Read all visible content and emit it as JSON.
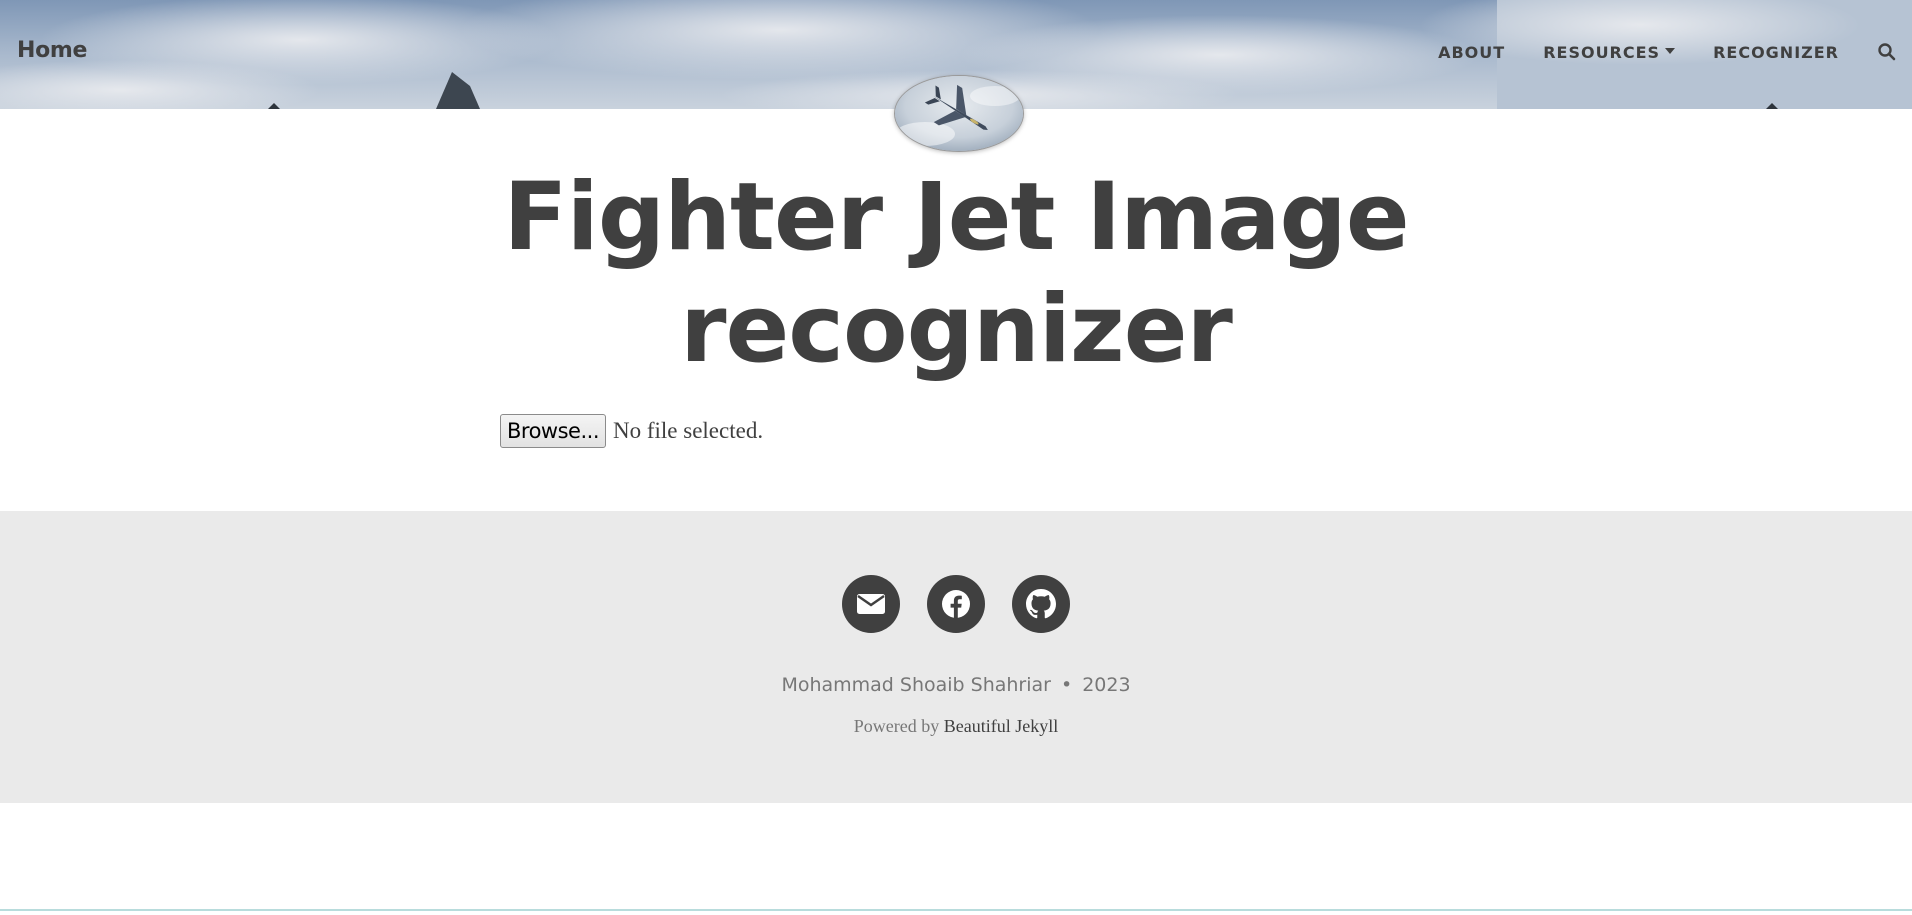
{
  "navbar": {
    "brand": "Home",
    "links": [
      {
        "label": "ABOUT"
      },
      {
        "label": "RESOURCES",
        "has_dropdown": true
      },
      {
        "label": "RECOGNIZER"
      }
    ],
    "search_icon": "search-icon"
  },
  "avatar": {
    "icon": "fighter-jet-photo"
  },
  "main": {
    "title_line1": "Fighter Jet Image",
    "title_line2": "recognizer",
    "file_input": {
      "button_label": "Browse...",
      "status": "No file selected."
    }
  },
  "footer": {
    "social_icons": [
      "email-icon",
      "facebook-icon",
      "github-icon"
    ],
    "author": "Mohammad Shoaib Shahriar",
    "separator": "•",
    "year": "2023",
    "powered_prefix": "Powered by",
    "powered_link": "Beautiful Jekyll"
  },
  "colors": {
    "text_dark": "#404040",
    "footer_bg": "#eaeaea",
    "footer_text": "#777777"
  }
}
